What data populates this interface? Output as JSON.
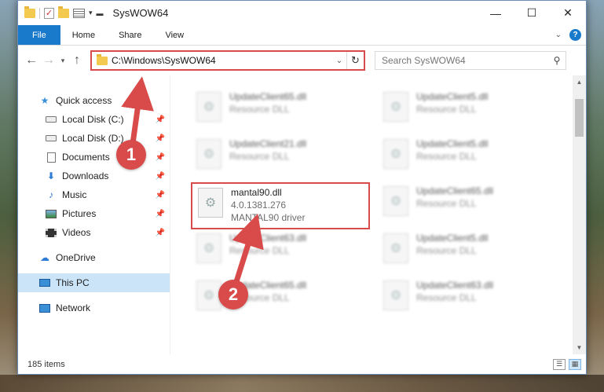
{
  "window": {
    "title": "SysWOW64",
    "controls": {
      "minimize": "—",
      "maximize": "☐",
      "close": "✕"
    }
  },
  "ribbon": {
    "tabs": [
      "File",
      "Home",
      "Share",
      "View"
    ],
    "help": "?"
  },
  "address": {
    "path": "C:\\Windows\\SysWOW64",
    "search_placeholder": "Search SysWOW64"
  },
  "nav": {
    "quick_access": "Quick access",
    "items": [
      {
        "label": "Local Disk (C:)",
        "icon": "drive-icon",
        "pinned": true
      },
      {
        "label": "Local Disk (D:)",
        "icon": "drive-icon",
        "pinned": true
      },
      {
        "label": "Documents",
        "icon": "documents-icon",
        "pinned": true
      },
      {
        "label": "Downloads",
        "icon": "downloads-icon",
        "pinned": true
      },
      {
        "label": "Music",
        "icon": "music-icon",
        "pinned": true
      },
      {
        "label": "Pictures",
        "icon": "pictures-icon",
        "pinned": true
      },
      {
        "label": "Videos",
        "icon": "videos-icon",
        "pinned": true
      }
    ],
    "onedrive": "OneDrive",
    "this_pc": "This PC",
    "network": "Network"
  },
  "files": [
    {
      "name": "UpdateClient65.dll",
      "sub": "Resource DLL",
      "blurred": true
    },
    {
      "name": "UpdateClient5.dll",
      "sub": "Resource DLL",
      "blurred": true
    },
    {
      "name": "UpdateClient21.dll",
      "sub": "Resource DLL",
      "blurred": true
    },
    {
      "name": "UpdateClient5.dll",
      "sub": "Resource DLL",
      "blurred": true
    },
    {
      "name": "mantal90.dll",
      "version": "4.0.1381.276",
      "sub": "MANTAL90 driver",
      "blurred": false,
      "highlighted": true
    },
    {
      "name": "UpdateClient65.dll",
      "sub": "Resource DLL",
      "blurred": true
    },
    {
      "name": "UpdateClient63.dll",
      "sub": "Resource DLL",
      "blurred": true
    },
    {
      "name": "UpdateClient5.dll",
      "sub": "Resource DLL",
      "blurred": true
    },
    {
      "name": "UpdateClient65.dll",
      "sub": "Resource DLL",
      "blurred": true
    },
    {
      "name": "UpdateClient63.dll",
      "sub": "Resource DLL",
      "blurred": true
    }
  ],
  "status": {
    "count": "185 items"
  },
  "annotations": {
    "step1": "1",
    "step2": "2",
    "color": "#d94b4b"
  }
}
